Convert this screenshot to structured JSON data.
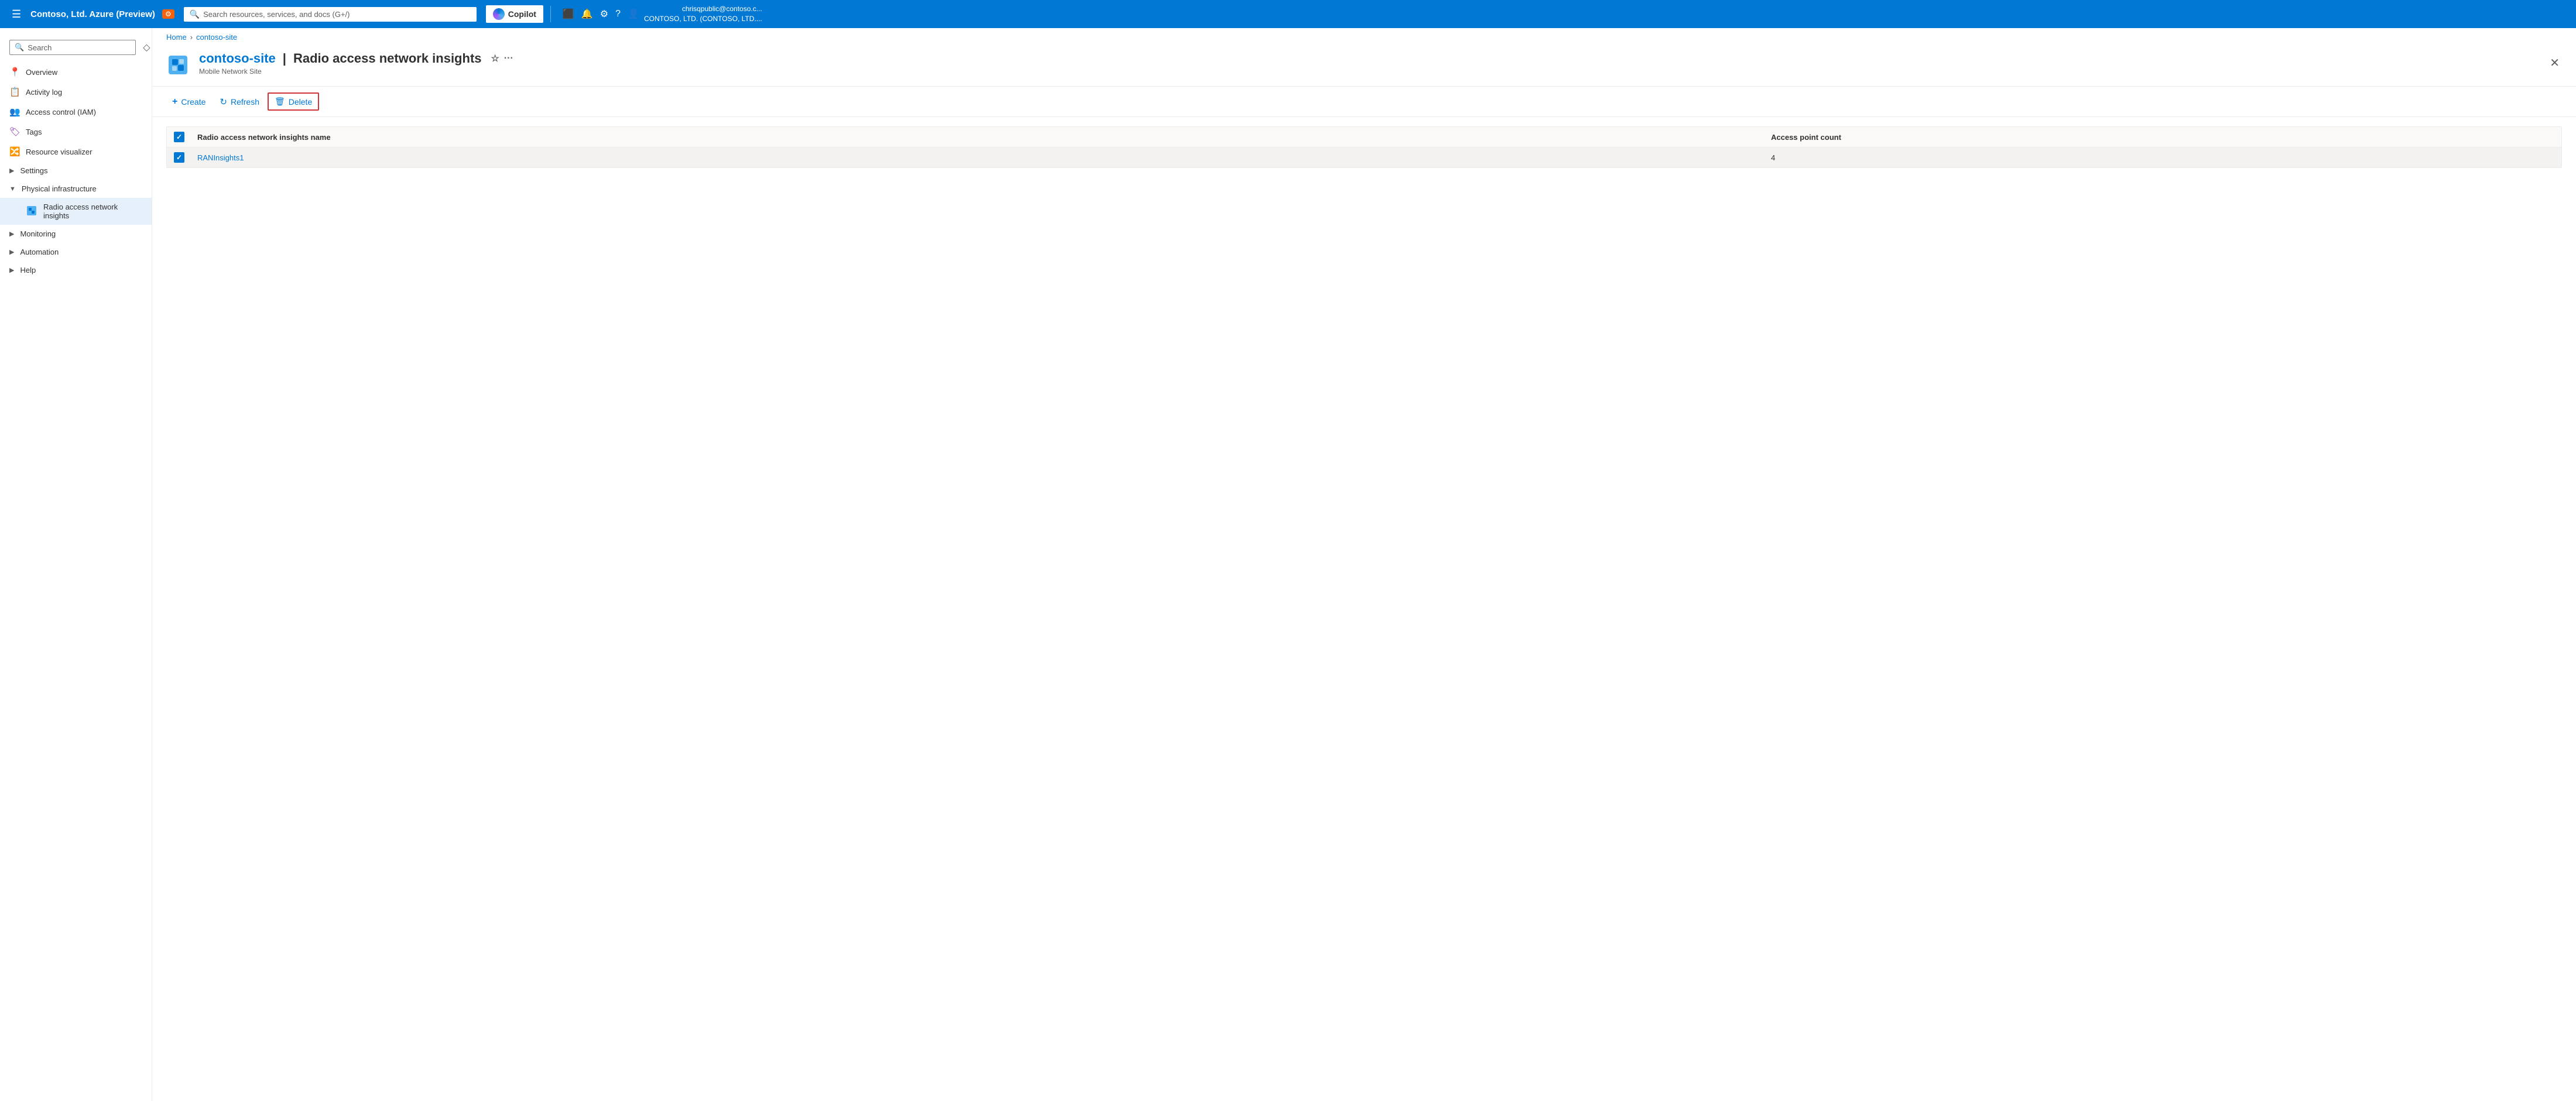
{
  "topbar": {
    "hamburger_label": "☰",
    "title": "Contoso, Ltd. Azure (Preview)",
    "badge": "⚙",
    "search_placeholder": "Search resources, services, and docs (G+/)",
    "copilot_label": "Copilot",
    "icons": [
      "▶",
      "🔔",
      "⚙",
      "?",
      "👤"
    ],
    "user_line1": "chrisqpublic@contoso.c...",
    "user_line2": "CONTOSO, LTD. (CONTOSO, LTD...."
  },
  "sidebar": {
    "search_placeholder": "Search",
    "nav_items": [
      {
        "id": "overview",
        "icon": "📍",
        "label": "Overview",
        "type": "item"
      },
      {
        "id": "activity-log",
        "icon": "📋",
        "label": "Activity log",
        "type": "item"
      },
      {
        "id": "access-control",
        "icon": "👥",
        "label": "Access control (IAM)",
        "type": "item"
      },
      {
        "id": "tags",
        "icon": "🏷",
        "label": "Tags",
        "type": "item"
      },
      {
        "id": "resource-visualizer",
        "icon": "🔀",
        "label": "Resource visualizer",
        "type": "item"
      },
      {
        "id": "settings",
        "icon": "",
        "label": "Settings",
        "type": "expandable",
        "expanded": false
      },
      {
        "id": "physical-infrastructure",
        "icon": "",
        "label": "Physical infrastructure",
        "type": "expandable",
        "expanded": true
      },
      {
        "id": "ran-insights",
        "icon": "📦",
        "label": "Radio access network insights",
        "type": "subitem",
        "active": true
      },
      {
        "id": "monitoring",
        "icon": "",
        "label": "Monitoring",
        "type": "expandable",
        "expanded": false
      },
      {
        "id": "automation",
        "icon": "",
        "label": "Automation",
        "type": "expandable",
        "expanded": false
      },
      {
        "id": "help",
        "icon": "",
        "label": "Help",
        "type": "expandable",
        "expanded": false
      }
    ]
  },
  "breadcrumb": {
    "items": [
      {
        "label": "Home",
        "link": true
      },
      {
        "label": "contoso-site",
        "link": true
      }
    ]
  },
  "page": {
    "resource_name": "contoso-site",
    "page_name": "Radio access network insights",
    "subtitle": "Mobile Network Site"
  },
  "toolbar": {
    "create_label": "Create",
    "refresh_label": "Refresh",
    "delete_label": "Delete"
  },
  "table": {
    "col_name_header": "Radio access network insights name",
    "col_count_header": "Access point count",
    "rows": [
      {
        "name": "RANInsights1",
        "count": "4"
      }
    ]
  }
}
